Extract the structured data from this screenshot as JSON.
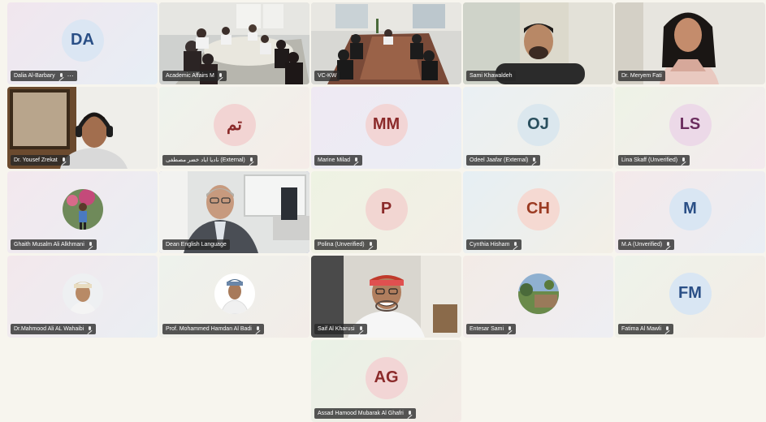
{
  "participants": [
    {
      "name": "Dalia Al-Barbary",
      "initials": "DA",
      "bg": "linear-gradient(135deg,#f1e6ee,#e7eef5)",
      "avatar_bg": "#dbe6f3",
      "avatar_fg": "#2a4f86",
      "type": "initials",
      "more": "⋯"
    },
    {
      "name": "Academic Affairs M",
      "type": "video-room"
    },
    {
      "name": "VC-KW",
      "type": "video-room2"
    },
    {
      "name": "Sami Khawaldeh",
      "type": "video-person"
    },
    {
      "name": "Dr. Meryem Fati",
      "type": "video-woman"
    },
    {
      "name": "Dr. Yousef Zrekat",
      "type": "video-headset"
    },
    {
      "name": "ناديا اياد خضر مصطفى (External)",
      "initials": "تم",
      "bg": "linear-gradient(135deg,#eef3ec,#f5ece8)",
      "avatar_bg": "#f2d4d3",
      "avatar_fg": "#8b2a2a",
      "type": "initials"
    },
    {
      "name": "Marine Milad",
      "initials": "MM",
      "bg": "linear-gradient(135deg,#efe9f3,#eaeef4)",
      "avatar_bg": "#f2d5d5",
      "avatar_fg": "#8b2a2a",
      "type": "initials"
    },
    {
      "name": "Odeel Jaafar (External)",
      "initials": "OJ",
      "bg": "linear-gradient(135deg,#eaf0f4,#f2efe7)",
      "avatar_bg": "#dbe7ee",
      "avatar_fg": "#2a4f5e",
      "type": "initials"
    },
    {
      "name": "Lina Skaff (Unverified)",
      "initials": "LS",
      "bg": "linear-gradient(135deg,#eef3e6,#f3eaee)",
      "avatar_bg": "#ecd9e8",
      "avatar_fg": "#6b2d5e",
      "type": "initials"
    },
    {
      "name": "Ghaith Musalm Ali Alkhmani",
      "type": "photo-avatar",
      "photo": "boy"
    },
    {
      "name": "Dean English Language",
      "type": "video-dean",
      "active": true
    },
    {
      "name": "Polina (Unverified)",
      "initials": "P",
      "bg": "linear-gradient(135deg,#eef3e3,#f3eee6)",
      "avatar_bg": "#f2d6d2",
      "avatar_fg": "#8b2a2a",
      "type": "initials"
    },
    {
      "name": "Cynthia Hisham",
      "initials": "CH",
      "bg": "linear-gradient(135deg,#e6eff4,#f3efe6)",
      "avatar_bg": "#f5d9d2",
      "avatar_fg": "#9b3a22",
      "type": "initials"
    },
    {
      "name": "M.A (Unverified)",
      "initials": "M",
      "bg": "linear-gradient(135deg,#f4e9ea,#eaeef4)",
      "avatar_bg": "#d9e6f3",
      "avatar_fg": "#2a4f86",
      "type": "initials"
    },
    {
      "name": "Dr.Mahmood Ali AL Wahaibi",
      "type": "photo-avatar",
      "photo": "omani"
    },
    {
      "name": "Prof. Mohammed Hamdan Al Badi",
      "type": "photo-avatar",
      "photo": "omani2"
    },
    {
      "name": "Saif Al Kharusi",
      "type": "video-saif"
    },
    {
      "name": "Entesar Sami",
      "type": "photo-avatar",
      "photo": "landscape"
    },
    {
      "name": "Fatima Al Mawli",
      "initials": "FM",
      "bg": "linear-gradient(135deg,#eef3ea,#f3ece6)",
      "avatar_bg": "#d9e6f3",
      "avatar_fg": "#2a4f86",
      "type": "initials"
    },
    {
      "name": "Assad Hamood Mubarak Al Ghafri",
      "initials": "AG",
      "bg": "linear-gradient(135deg,#e9f2e6,#f3ebe6)",
      "avatar_bg": "#f2d5d5",
      "avatar_fg": "#8b2a2a",
      "type": "initials"
    }
  ]
}
